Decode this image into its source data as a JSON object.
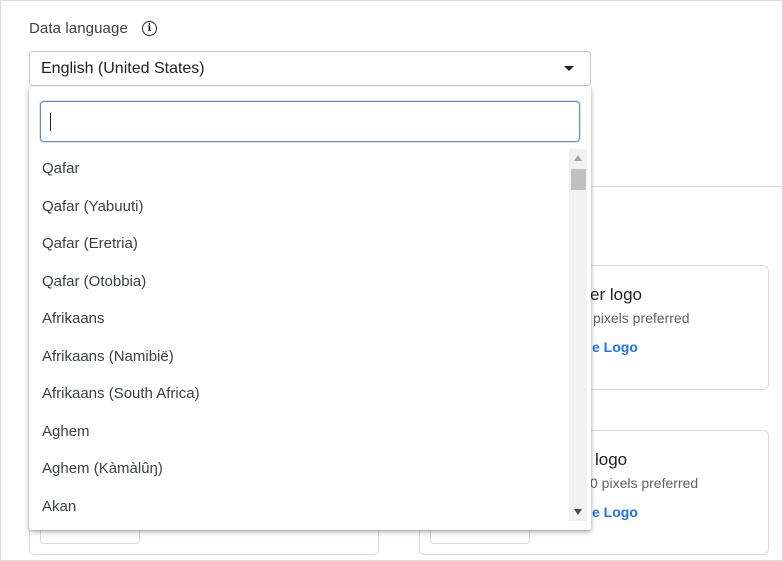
{
  "field": {
    "label": "Data language",
    "selected": "English (United States)"
  },
  "search": {
    "value": "",
    "placeholder": ""
  },
  "languages": [
    "Qafar",
    "Qafar (Yabuuti)",
    "Qafar (Eretria)",
    "Qafar (Otobbia)",
    "Afrikaans",
    "Afrikaans (Namibië)",
    "Afrikaans (South Africa)",
    "Aghem",
    "Aghem (Kàmàlûŋ)",
    "Akan"
  ],
  "cards": [
    {
      "title": "er logo",
      "subtitle": "pixels preferred",
      "link": "e Logo"
    },
    {
      "title": "logo",
      "subtitle": "0 pixels preferred",
      "link": "e Logo"
    }
  ],
  "colors": {
    "link": "#1a73e8",
    "focus": "#5f8fc9",
    "border": "#dadce0"
  }
}
